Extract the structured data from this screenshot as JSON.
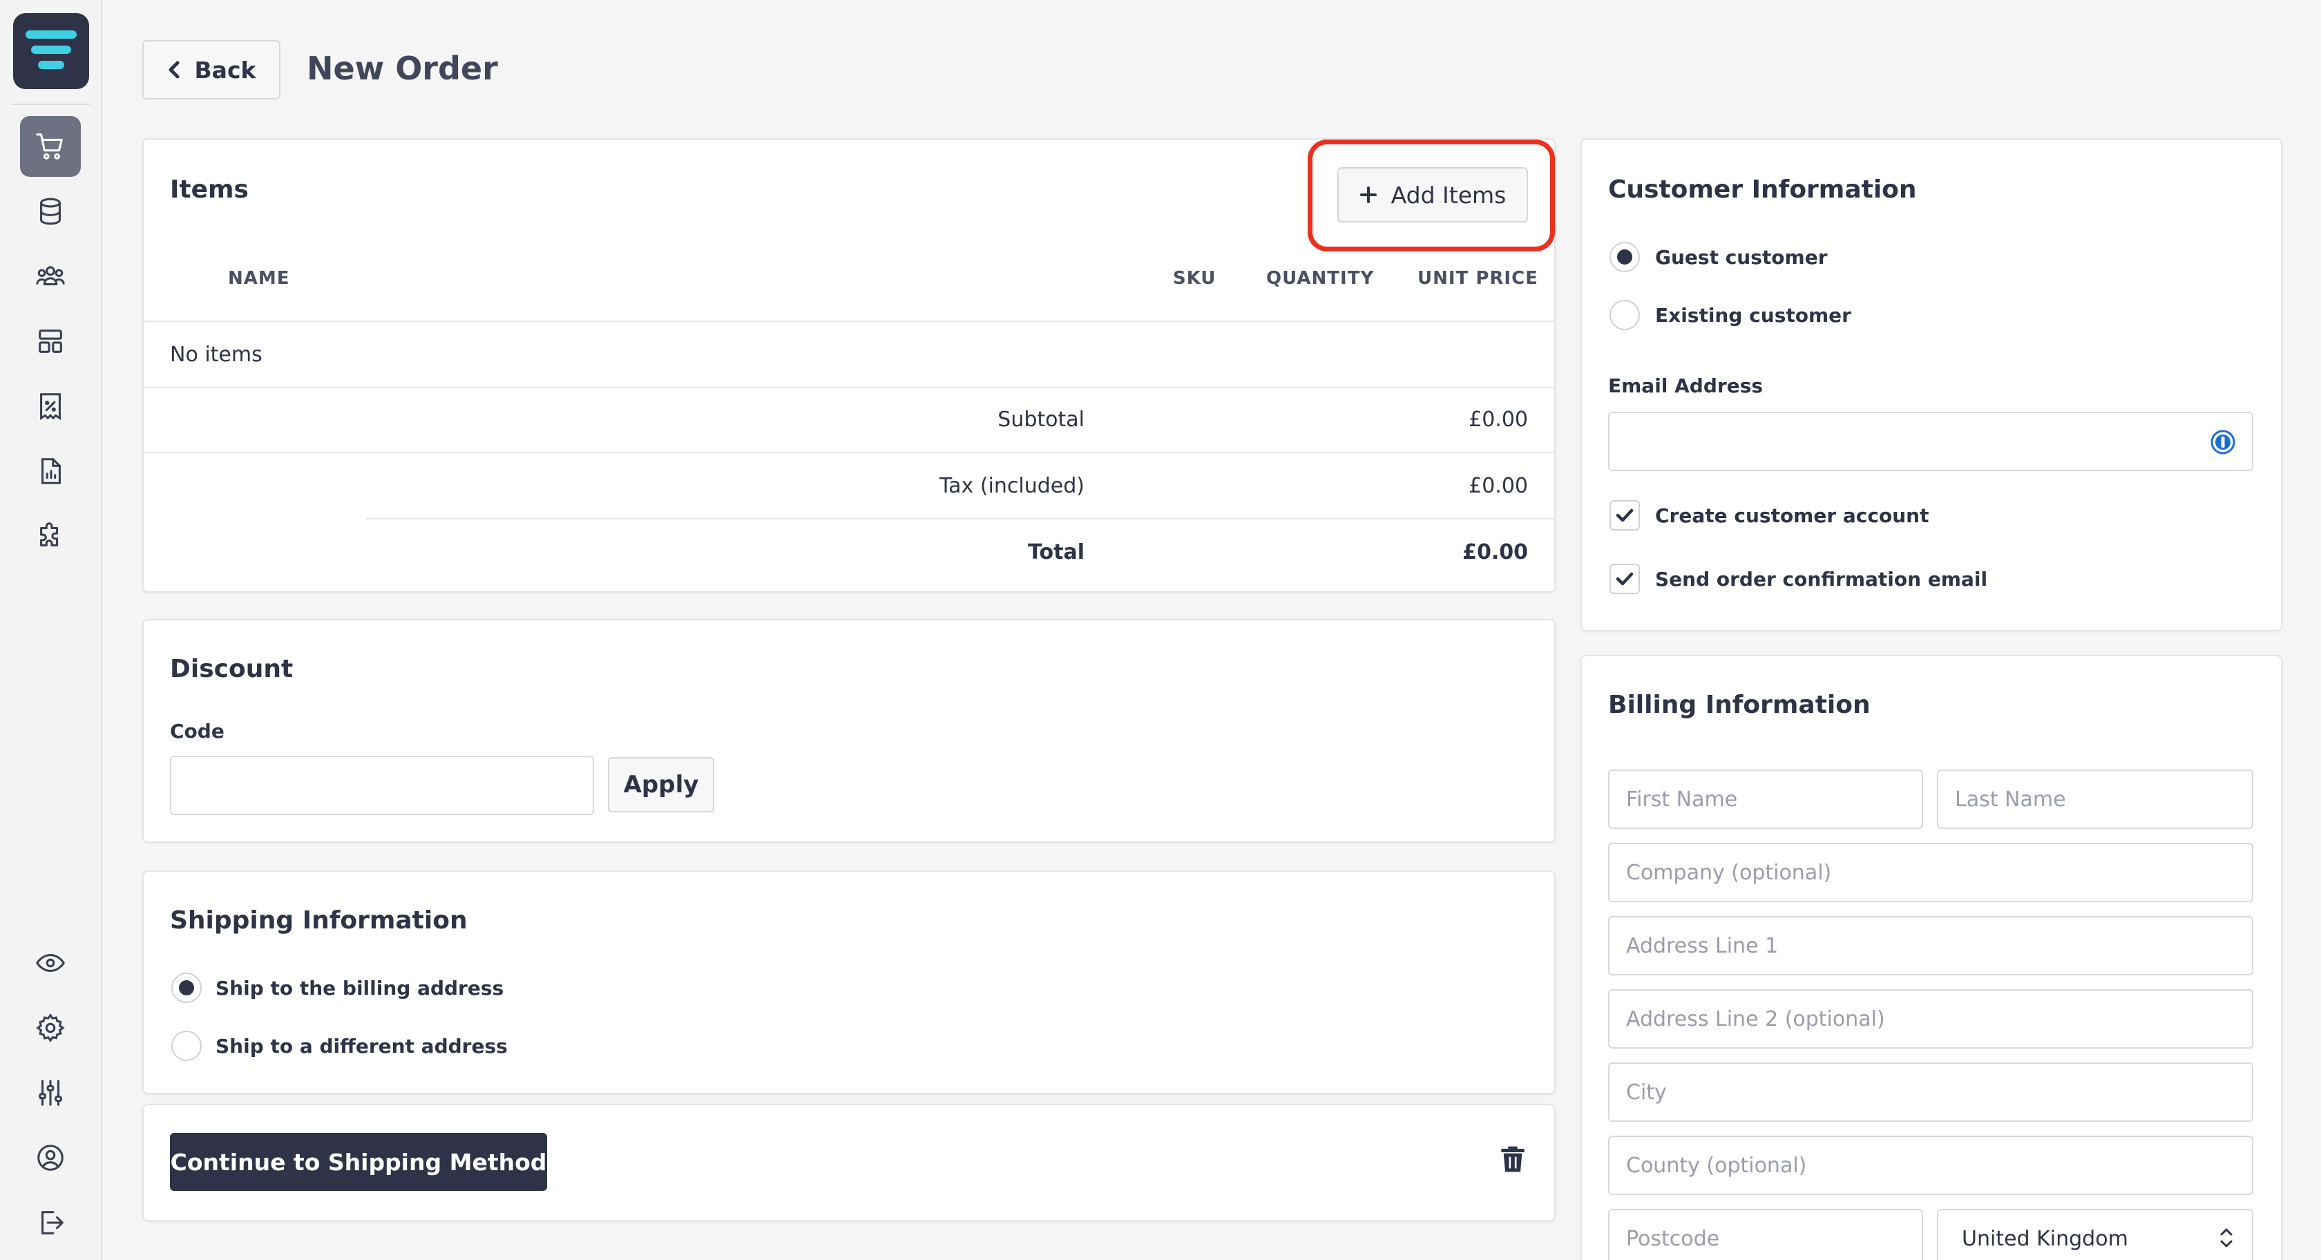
{
  "header": {
    "back_label": "Back",
    "title": "New Order"
  },
  "sidebar": {
    "items": [
      {
        "icon": "cart-icon",
        "active": true
      },
      {
        "icon": "database-icon",
        "active": false
      },
      {
        "icon": "users-icon",
        "active": false
      },
      {
        "icon": "layout-icon",
        "active": false
      },
      {
        "icon": "discount-receipt-icon",
        "active": false
      },
      {
        "icon": "report-icon",
        "active": false
      },
      {
        "icon": "puzzle-icon",
        "active": false
      },
      {
        "icon": "eye-icon",
        "active": false
      },
      {
        "icon": "gear-icon",
        "active": false
      },
      {
        "icon": "sliders-icon",
        "active": false
      },
      {
        "icon": "user-circle-icon",
        "active": false
      },
      {
        "icon": "logout-icon",
        "active": false
      }
    ]
  },
  "items_card": {
    "title": "Items",
    "add_items_label": "Add Items",
    "columns": [
      "NAME",
      "SKU",
      "QUANTITY",
      "UNIT PRICE"
    ],
    "empty_text": "No items",
    "subtotal_label": "Subtotal",
    "subtotal_value": "£0.00",
    "tax_label": "Tax (included)",
    "tax_value": "£0.00",
    "total_label": "Total",
    "total_value": "£0.00"
  },
  "discount_card": {
    "title": "Discount",
    "code_label": "Code",
    "code_value": "",
    "apply_label": "Apply"
  },
  "shipping_card": {
    "title": "Shipping Information",
    "options": [
      {
        "label": "Ship to the billing address",
        "checked": true
      },
      {
        "label": "Ship to a different address",
        "checked": false
      }
    ]
  },
  "actions": {
    "continue_label": "Continue to Shipping Method"
  },
  "customer_card": {
    "title": "Customer Information",
    "options": [
      {
        "label": "Guest customer",
        "checked": true
      },
      {
        "label": "Existing customer",
        "checked": false
      }
    ],
    "email_label": "Email Address",
    "email_value": "",
    "create_account_label": "Create customer account",
    "send_email_label": "Send order confirmation email"
  },
  "billing_card": {
    "title": "Billing Information",
    "first_name_placeholder": "First Name",
    "last_name_placeholder": "Last Name",
    "company_placeholder": "Company (optional)",
    "address1_placeholder": "Address Line 1",
    "address2_placeholder": "Address Line 2 (optional)",
    "city_placeholder": "City",
    "county_placeholder": "County (optional)",
    "postcode_placeholder": "Postcode",
    "country_value": "United Kingdom"
  },
  "colors": {
    "primary": "#2e3347",
    "highlight": "#e8321e",
    "logo_accent": "#3fd0e6"
  }
}
